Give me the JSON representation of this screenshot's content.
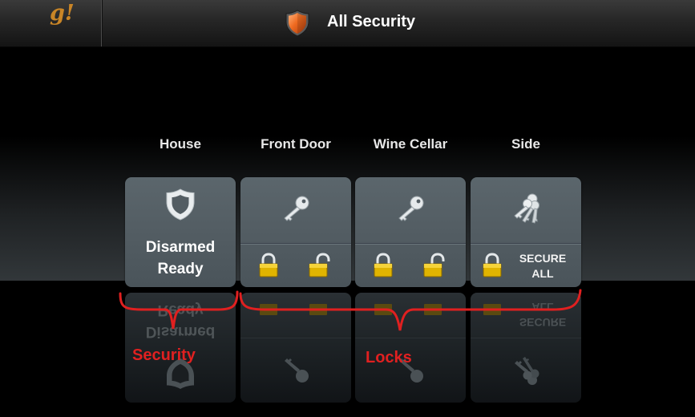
{
  "header": {
    "logo_text": "g!",
    "title": "All Security",
    "title_icon": "shield-icon"
  },
  "devices": [
    {
      "label": "House",
      "type": "security",
      "icon": "shield-outline-icon",
      "status_lines": [
        "Disarmed",
        "Ready"
      ]
    },
    {
      "label": "Front Door",
      "type": "lock",
      "icon": "key-icon",
      "buttons": [
        "lock-icon",
        "unlock-icon"
      ]
    },
    {
      "label": "Wine Cellar",
      "type": "lock",
      "icon": "key-icon",
      "buttons": [
        "lock-icon",
        "unlock-icon"
      ]
    },
    {
      "label": "Side",
      "type": "lock-group",
      "icon": "keys-icon",
      "buttons": [
        "lock-icon"
      ],
      "secure_all_lines": [
        "SECURE",
        "ALL"
      ]
    }
  ],
  "annotations": {
    "security_label": "Security",
    "locks_label": "Locks",
    "color": "#e02020"
  },
  "colors": {
    "accent_orange": "#e06a22",
    "logo_gold": "#c98526",
    "lock_gold": "#e0b400"
  }
}
